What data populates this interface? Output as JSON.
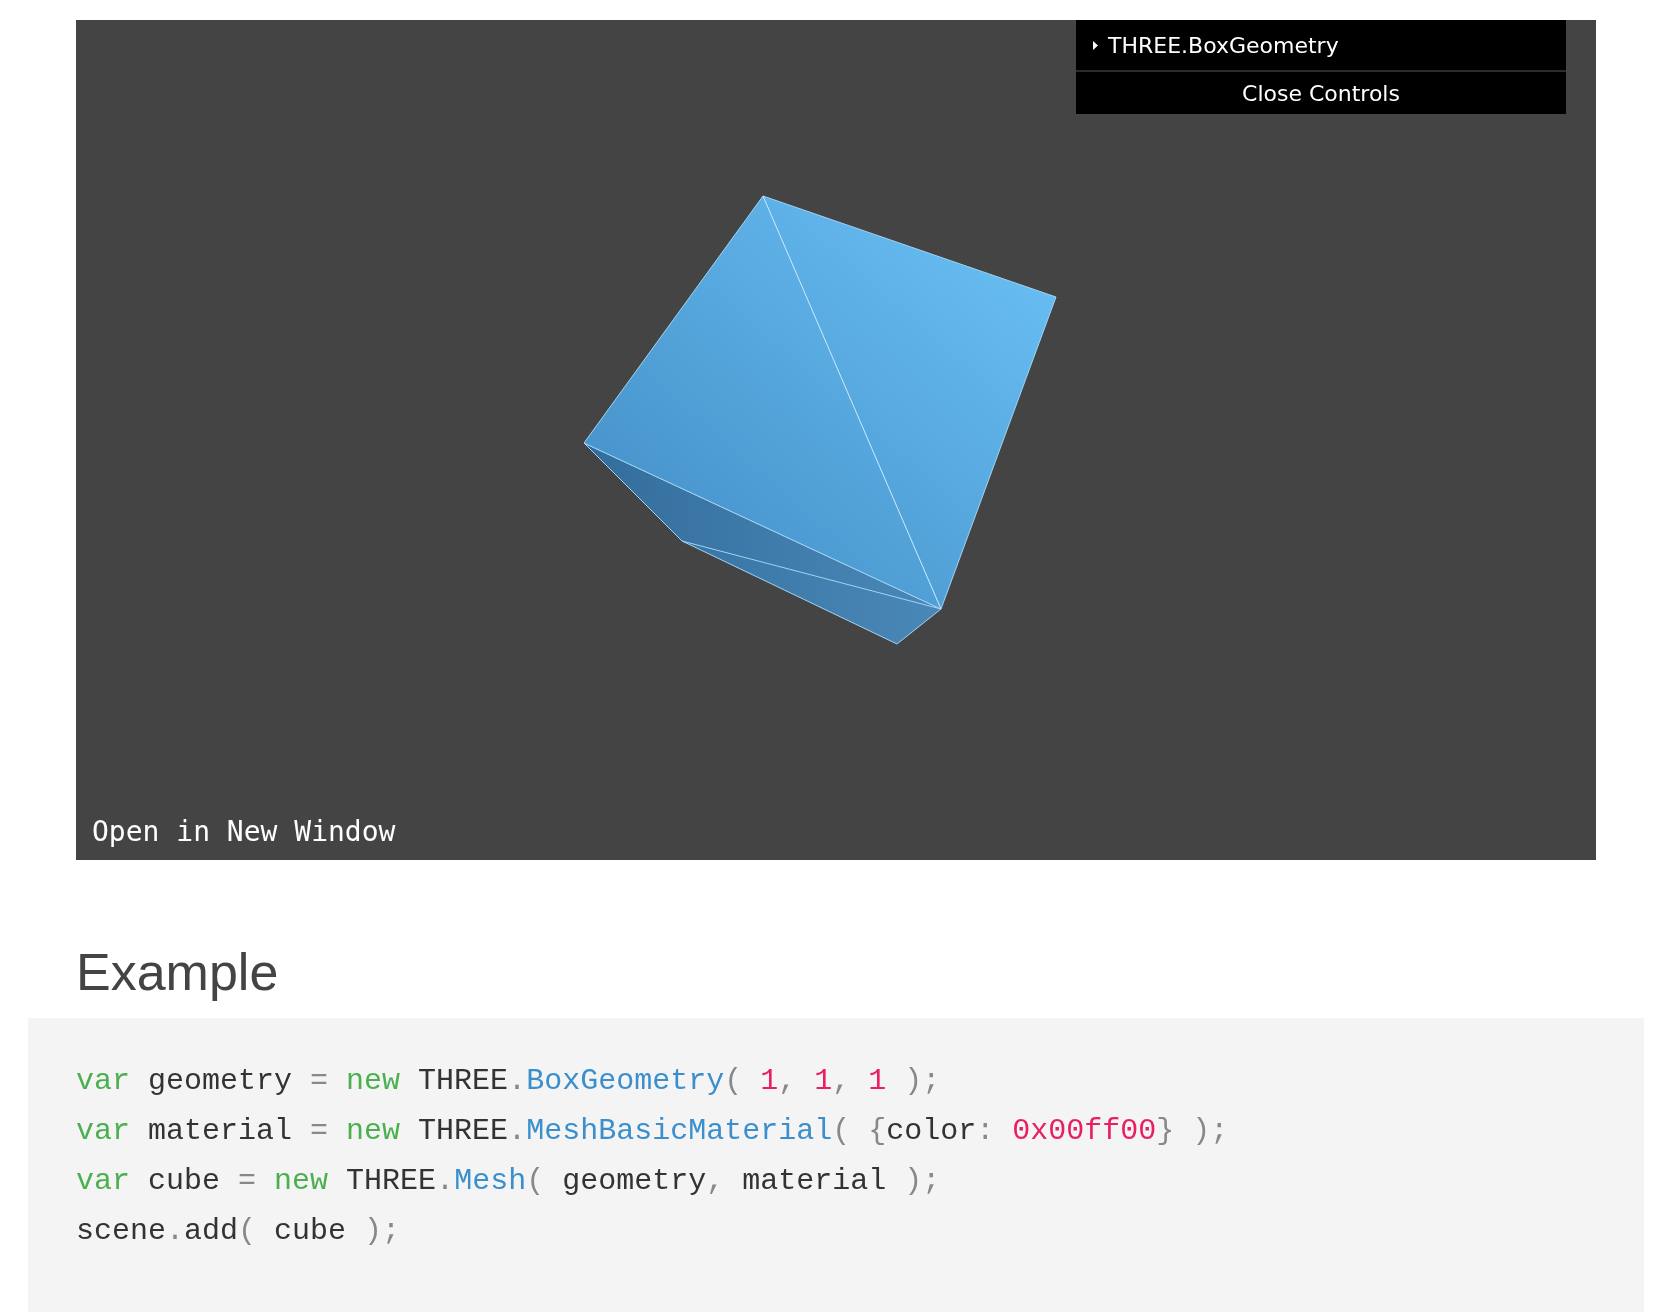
{
  "viewer": {
    "controls": {
      "folder": {
        "label": "THREE.BoxGeometry",
        "expanded": false
      },
      "close_button": "Close Controls"
    },
    "link": "Open in New Window"
  },
  "heading": "Example",
  "code": [
    [
      {
        "kind": "keyword",
        "s": "var"
      },
      {
        "kind": "name",
        "s": " geometry "
      },
      {
        "kind": "punct",
        "s": "= "
      },
      {
        "kind": "keyword",
        "s": "new"
      },
      {
        "kind": "name",
        "s": " THREE"
      },
      {
        "kind": "punct",
        "s": "."
      },
      {
        "kind": "function",
        "s": "BoxGeometry"
      },
      {
        "kind": "punct",
        "s": "( "
      },
      {
        "kind": "number",
        "s": "1"
      },
      {
        "kind": "punct",
        "s": ", "
      },
      {
        "kind": "number",
        "s": "1"
      },
      {
        "kind": "punct",
        "s": ", "
      },
      {
        "kind": "number",
        "s": "1"
      },
      {
        "kind": "punct",
        "s": " );"
      }
    ],
    [
      {
        "kind": "keyword",
        "s": "var"
      },
      {
        "kind": "name",
        "s": " material "
      },
      {
        "kind": "punct",
        "s": "= "
      },
      {
        "kind": "keyword",
        "s": "new"
      },
      {
        "kind": "name",
        "s": " THREE"
      },
      {
        "kind": "punct",
        "s": "."
      },
      {
        "kind": "function",
        "s": "MeshBasicMaterial"
      },
      {
        "kind": "punct",
        "s": "( {"
      },
      {
        "kind": "name",
        "s": "color"
      },
      {
        "kind": "punct",
        "s": ": "
      },
      {
        "kind": "number",
        "s": "0x00ff00"
      },
      {
        "kind": "punct",
        "s": "} );"
      }
    ],
    [
      {
        "kind": "keyword",
        "s": "var"
      },
      {
        "kind": "name",
        "s": " cube "
      },
      {
        "kind": "punct",
        "s": "= "
      },
      {
        "kind": "keyword",
        "s": "new"
      },
      {
        "kind": "name",
        "s": " THREE"
      },
      {
        "kind": "punct",
        "s": "."
      },
      {
        "kind": "function",
        "s": "Mesh"
      },
      {
        "kind": "punct",
        "s": "( "
      },
      {
        "kind": "name",
        "s": "geometry"
      },
      {
        "kind": "punct",
        "s": ", "
      },
      {
        "kind": "name",
        "s": "material"
      },
      {
        "kind": "punct",
        "s": " );"
      }
    ],
    [
      {
        "kind": "name",
        "s": "scene"
      },
      {
        "kind": "punct",
        "s": "."
      },
      {
        "kind": "name",
        "s": "add"
      },
      {
        "kind": "punct",
        "s": "( "
      },
      {
        "kind": "name",
        "s": "cube"
      },
      {
        "kind": "punct",
        "s": " );"
      }
    ]
  ]
}
